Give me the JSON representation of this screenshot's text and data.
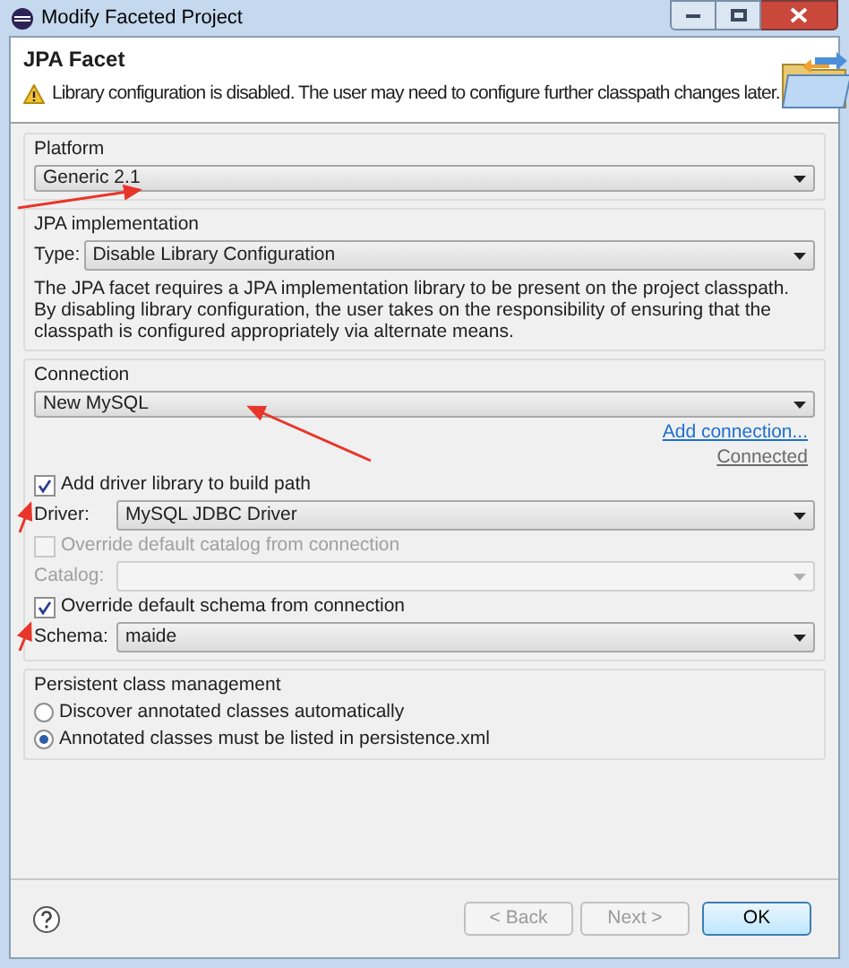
{
  "window": {
    "title": "Modify Faceted Project"
  },
  "header": {
    "title": "JPA Facet",
    "message": "Library configuration is disabled. The user may need to configure further classpath changes later."
  },
  "platform": {
    "label": "Platform",
    "value": "Generic 2.1"
  },
  "jpa_implementation": {
    "label": "JPA implementation",
    "type_label": "Type:",
    "type_value": "Disable Library Configuration",
    "description": "The JPA facet requires a JPA implementation library to be present on the project classpath. By disabling library configuration, the user takes on the responsibility of ensuring that the classpath is configured appropriately via alternate means."
  },
  "connection": {
    "label": "Connection",
    "value": "New MySQL",
    "add_link": "Add connection...",
    "status": "Connected",
    "add_driver": {
      "label": "Add driver library to build path",
      "checked": true,
      "disabled": false
    },
    "driver": {
      "label": "Driver:",
      "value": "MySQL JDBC Driver",
      "disabled": false
    },
    "override_catalog": {
      "label": "Override default catalog from connection",
      "checked": false,
      "disabled": true
    },
    "catalog": {
      "label": "Catalog:",
      "disabled": true
    },
    "override_schema": {
      "label": "Override default schema from connection",
      "checked": true,
      "disabled": false
    },
    "schema": {
      "label": "Schema:",
      "value": "maide",
      "disabled": false
    }
  },
  "persistent_class_management": {
    "label": "Persistent class management",
    "options": [
      {
        "label": "Discover annotated classes automatically",
        "selected": false
      },
      {
        "label": "Annotated classes must be listed in persistence.xml",
        "selected": true
      }
    ]
  },
  "buttons": [
    {
      "label": "< Back",
      "disabled": true,
      "default": false
    },
    {
      "label": "Next >",
      "disabled": true,
      "default": false
    },
    {
      "label": "OK",
      "disabled": false,
      "default": true
    }
  ]
}
